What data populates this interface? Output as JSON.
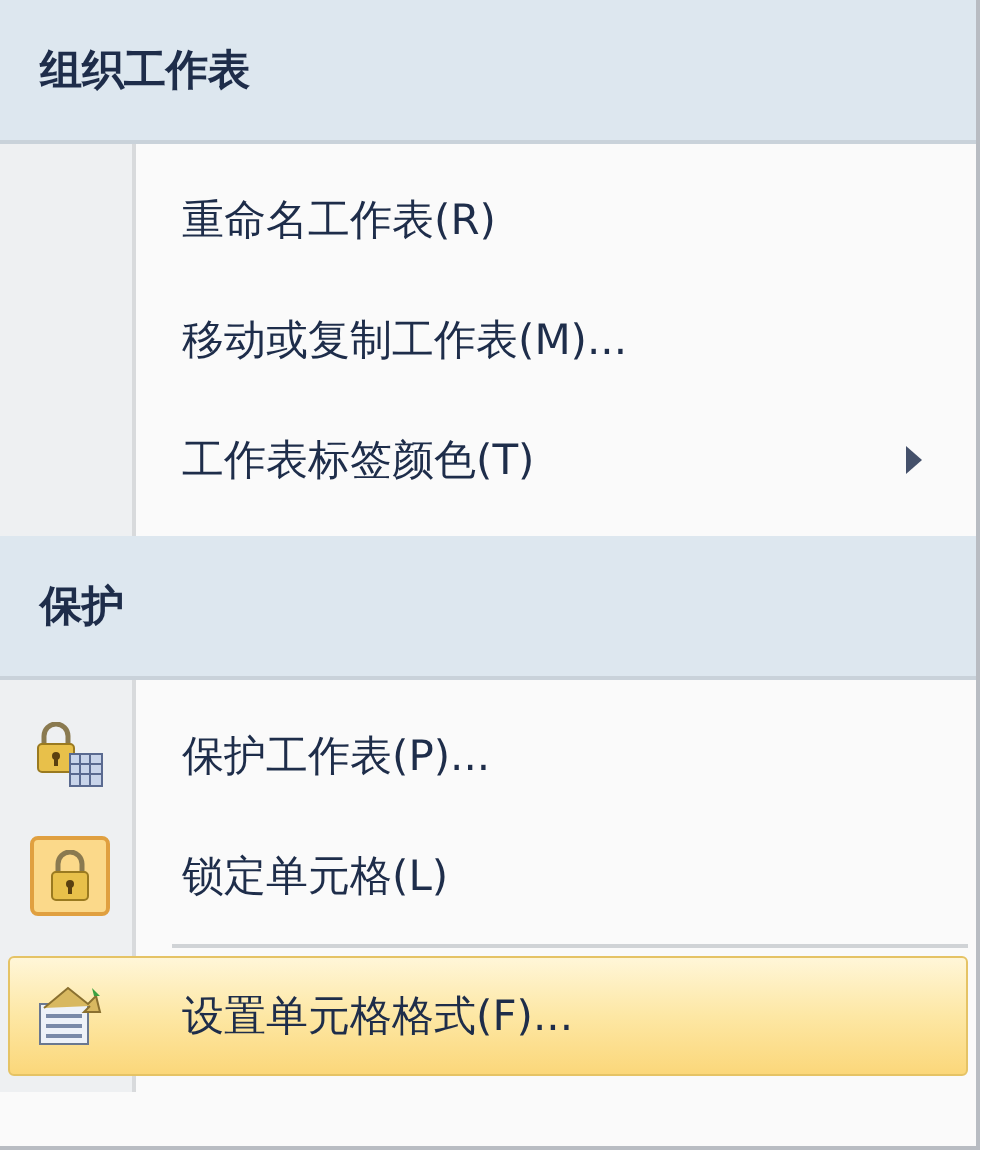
{
  "sections": [
    {
      "title": "组织工作表",
      "items": [
        {
          "label": "重命名工作表(R)",
          "kind": "plain",
          "checked": false,
          "selected": false,
          "submenu": false,
          "separator_before": false
        },
        {
          "label": "移动或复制工作表(M)...",
          "kind": "plain",
          "checked": false,
          "selected": false,
          "submenu": false,
          "separator_before": false
        },
        {
          "label": "工作表标签颜色(T)",
          "kind": "plain",
          "checked": false,
          "selected": false,
          "submenu": true,
          "separator_before": false
        }
      ]
    },
    {
      "title": "保护",
      "items": [
        {
          "label": "保护工作表(P)...",
          "kind": "protect",
          "checked": false,
          "selected": false,
          "submenu": false,
          "separator_before": false
        },
        {
          "label": "锁定单元格(L)",
          "kind": "lock",
          "checked": true,
          "selected": false,
          "submenu": false,
          "separator_before": false
        },
        {
          "label": "设置单元格格式(F)...",
          "kind": "format",
          "checked": false,
          "selected": true,
          "submenu": false,
          "separator_before": true
        }
      ]
    }
  ]
}
